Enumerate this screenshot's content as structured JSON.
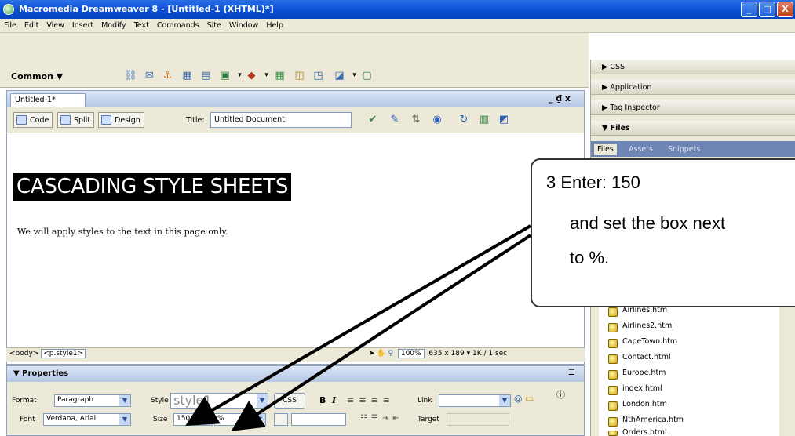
{
  "window": {
    "title": "Macromedia Dreamweaver 8 - [Untitled-1 (XHTML)*]",
    "min": "_",
    "max": "□",
    "close": "X"
  },
  "menu": [
    "File",
    "Edit",
    "View",
    "Insert",
    "Modify",
    "Text",
    "Commands",
    "Site",
    "Window",
    "Help"
  ],
  "insert_bar": {
    "category": "Common ▼"
  },
  "document": {
    "tab": "Untitled-1*",
    "controls": "_ ₫ x",
    "views": {
      "code": "Code",
      "split": "Split",
      "design": "Design"
    },
    "title_label": "Title:",
    "title_value": "Untitled Document",
    "heading": "CASCADING STYLE SHEETS",
    "paragraph": "We will apply styles to the text in this page only."
  },
  "status": {
    "tag_body": "<body>",
    "tag_p": "<p.style1>",
    "zoom": "100%",
    "dimensions": "635 x 189",
    "size": "1K / 1 sec"
  },
  "properties": {
    "header": "▼ Properties",
    "format_label": "Format",
    "format_value": "Paragraph",
    "style_label": "Style",
    "style_value": "style1",
    "css_button": "CSS",
    "bold": "B",
    "italic": "I",
    "link_label": "Link",
    "font_label": "Font",
    "font_value": "Verdana, Arial",
    "size_label": "Size",
    "size_value": "150",
    "unit_value": "%",
    "target_label": "Target"
  },
  "right_panels": {
    "css": "▶ CSS",
    "application": "▶ Application",
    "tag_inspector": "▶ Tag Inspector",
    "files": "▼ Files",
    "tabs": [
      "Files",
      "Assets",
      "Snippets"
    ],
    "files_list": [
      "Airlines.htm",
      "Airlines2.html",
      "CapeTown.htm",
      "Contact.html",
      "Europe.htm",
      "index.html",
      "London.htm",
      "NthAmerica.htm",
      "Orders.html"
    ]
  },
  "callout": {
    "line1": "3  Enter:    150",
    "line2": "and set the box next",
    "line3": "to %."
  }
}
